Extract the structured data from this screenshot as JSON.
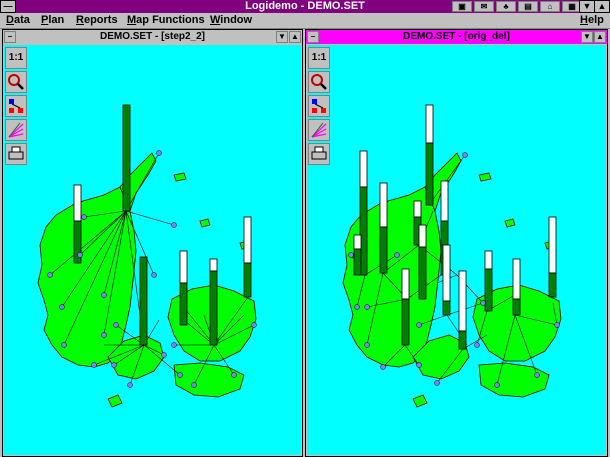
{
  "app": {
    "title": "Logidemo - DEMO.SET"
  },
  "menu": [
    {
      "key": "data",
      "label": "Data",
      "u": "D",
      "rest": "ata"
    },
    {
      "key": "plan",
      "label": "Plan",
      "u": "P",
      "rest": "lan"
    },
    {
      "key": "reports",
      "label": "Reports",
      "u": "R",
      "rest": "eports"
    },
    {
      "key": "map",
      "label": "Map Functions",
      "u": "M",
      "rest": "ap Functions"
    },
    {
      "key": "window",
      "label": "Window",
      "u": "W",
      "rest": "indow"
    },
    {
      "key": "help",
      "label": "Help",
      "u": "H",
      "rest": "elp"
    }
  ],
  "windows": {
    "left": {
      "title": "DEMO.SET - [step2_2]",
      "zoom_label": "1:1"
    },
    "right": {
      "title": "DEMO.SET - [orig_del]",
      "zoom_label": "1:1"
    }
  },
  "colors": {
    "land": "#00ff00",
    "sea": "#00ffff",
    "bar_fill": "#008000",
    "bar_empty": "#ffffff",
    "accent": "#800080",
    "active_caption": "#ff00ff"
  },
  "icons": [
    "zoom-in-icon",
    "network-icon",
    "routes-icon",
    "print-icon"
  ]
}
